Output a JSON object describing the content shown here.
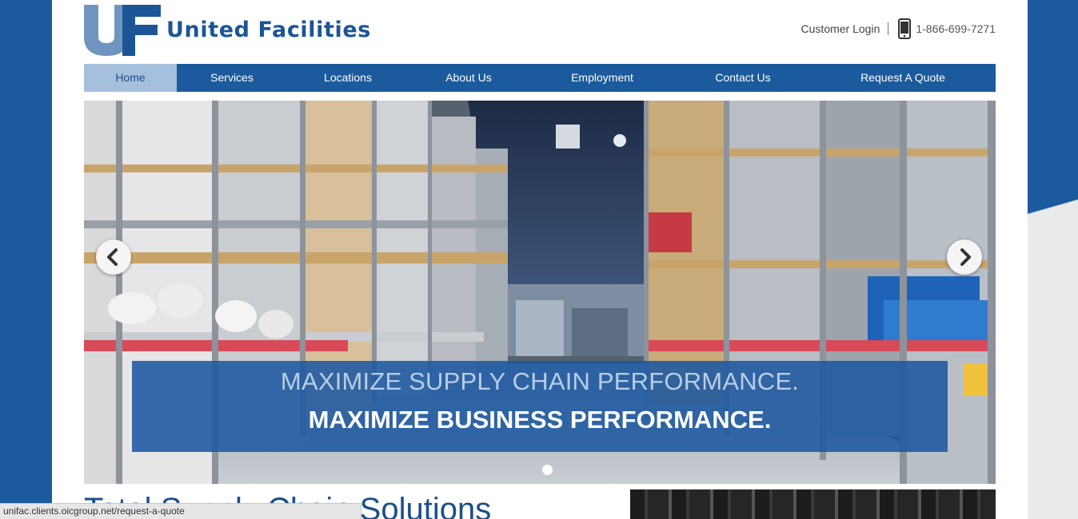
{
  "brand": {
    "logo_letters": "UF",
    "name": "United Facilities",
    "color": "#1c5596"
  },
  "header": {
    "login_label": "Customer Login",
    "phone_icon": "mobile-phone-icon",
    "phone_number": "1-866-699-7271"
  },
  "nav": {
    "active": "Home",
    "items": [
      {
        "label": "Home"
      },
      {
        "label": "Services"
      },
      {
        "label": "Locations"
      },
      {
        "label": "About Us"
      },
      {
        "label": "Employment"
      },
      {
        "label": "Contact Us"
      },
      {
        "label": "Request A Quote"
      }
    ]
  },
  "hero": {
    "headline_1": "MAXIMIZE SUPPLY CHAIN PERFORMANCE.",
    "headline_2": "MAXIMIZE BUSINESS PERFORMANCE.",
    "prev_icon": "chevron-left-icon",
    "next_icon": "chevron-right-icon",
    "slide_count": 1,
    "active_slide": 1
  },
  "main": {
    "section_title": "Total Supply Chain Solutions"
  },
  "status_bar": {
    "url": "unifac.clients.oicgroup.net/request-a-quote"
  },
  "colors": {
    "primary": "#1b5a9c",
    "nav_active_bg": "#a6bfdd",
    "caption_bg": "#1c58a0"
  }
}
